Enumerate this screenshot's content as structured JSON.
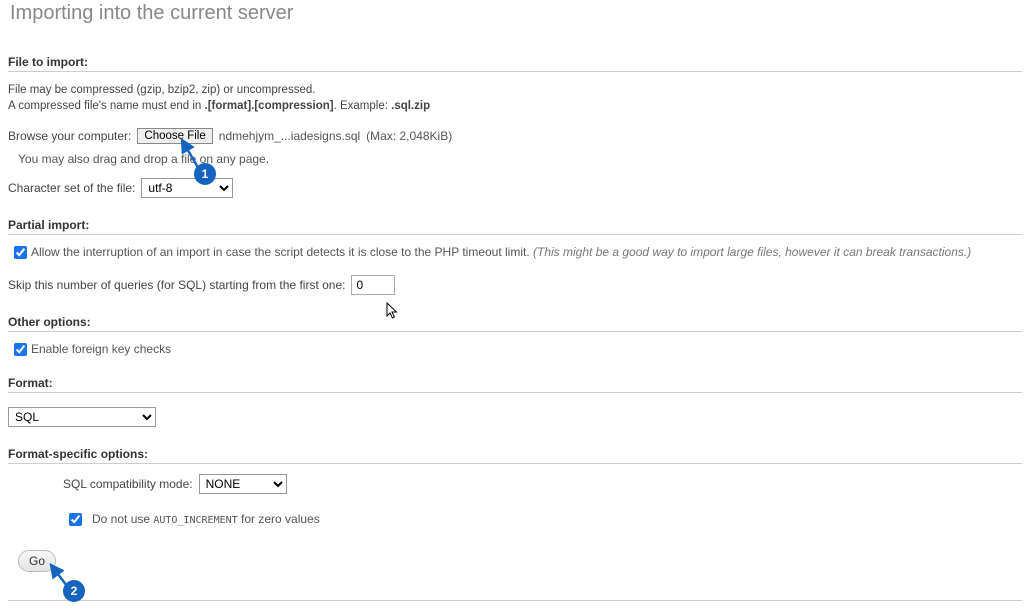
{
  "page_title": "Importing into the current server",
  "file_to_import": {
    "header": "File to import:",
    "desc_line1": "File may be compressed (gzip, bzip2, zip) or uncompressed.",
    "desc_line2_prefix": "A compressed file's name must end in ",
    "desc_line2_bold": ".[format].[compression]",
    "desc_line2_mid": ". Example: ",
    "desc_line2_example": ".sql.zip",
    "browse_label": "Browse your computer:",
    "choose_file_btn": "Choose File",
    "file_name": "ndmehjym_...iadesigns.sql",
    "max_size": "(Max: 2,048KiB)",
    "drag_hint": "You may also drag and drop a file on any page.",
    "charset_label": "Character set of the file:",
    "charset_value": "utf-8"
  },
  "partial_import": {
    "header": "Partial import:",
    "allow_interrupt_checked": true,
    "allow_interrupt_label": "Allow the interruption of an import in case the script detects it is close to the PHP timeout limit. ",
    "allow_interrupt_note": "(This might be a good way to import large files, however it can break transactions.)",
    "skip_label": "Skip this number of queries (for SQL) starting from the first one:",
    "skip_value": "0"
  },
  "other_options": {
    "header": "Other options:",
    "fk_checked": true,
    "fk_label": "Enable foreign key checks"
  },
  "format": {
    "header": "Format:",
    "value": "SQL"
  },
  "format_specific": {
    "header": "Format-specific options:",
    "compat_label": "SQL compatibility mode:",
    "compat_value": "NONE",
    "zero_auto_checked": true,
    "zero_auto_prefix": "Do not use ",
    "zero_auto_code": "AUTO_INCREMENT",
    "zero_auto_suffix": " for zero values"
  },
  "go_button": "Go",
  "annotations": {
    "one": "1",
    "two": "2"
  }
}
